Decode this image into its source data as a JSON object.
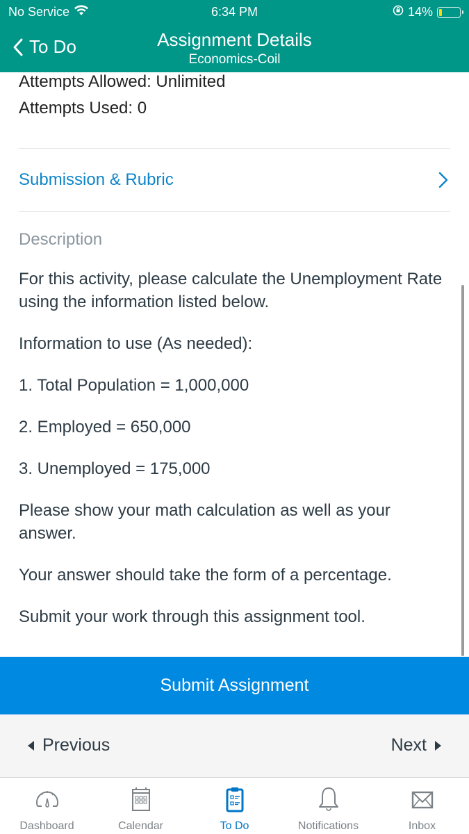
{
  "status_bar": {
    "carrier": "No Service",
    "time": "6:34 PM",
    "battery_percent": "14%",
    "battery_level": 0.14,
    "battery_fill_color": "#ffd60a"
  },
  "header": {
    "back_label": "To Do",
    "title": "Assignment Details",
    "subtitle": "Economics-Coil",
    "background_color": "#009688"
  },
  "attempts": {
    "allowed": "Attempts Allowed: Unlimited",
    "used": "Attempts Used: 0"
  },
  "submission_rubric": {
    "label": "Submission & Rubric",
    "link_color": "#0f85c9"
  },
  "description": {
    "heading": "Description",
    "paragraphs": [
      "For this activity, please calculate the Unemployment Rate using the information listed below.",
      "Information to use (As needed):",
      "1. Total Population = 1,000,000",
      "2. Employed = 650,000",
      "3. Unemployed = 175,000",
      "Please show your math calculation as well as your answer.",
      "Your answer should take the form of a percentage.",
      "Submit your work through this assignment tool."
    ]
  },
  "submit": {
    "label": "Submit Assignment",
    "color": "#0089e0"
  },
  "pager": {
    "previous_label": "Previous",
    "next_label": "Next"
  },
  "tabbar": {
    "active_color": "#0076c6",
    "tabs": [
      {
        "label": "Dashboard",
        "icon": "dashboard-gauge-icon",
        "active": false
      },
      {
        "label": "Calendar",
        "icon": "calendar-icon",
        "active": false
      },
      {
        "label": "To Do",
        "icon": "clipboard-todo-icon",
        "active": true
      },
      {
        "label": "Notifications",
        "icon": "bell-icon",
        "active": false
      },
      {
        "label": "Inbox",
        "icon": "envelope-icon",
        "active": false
      }
    ]
  }
}
